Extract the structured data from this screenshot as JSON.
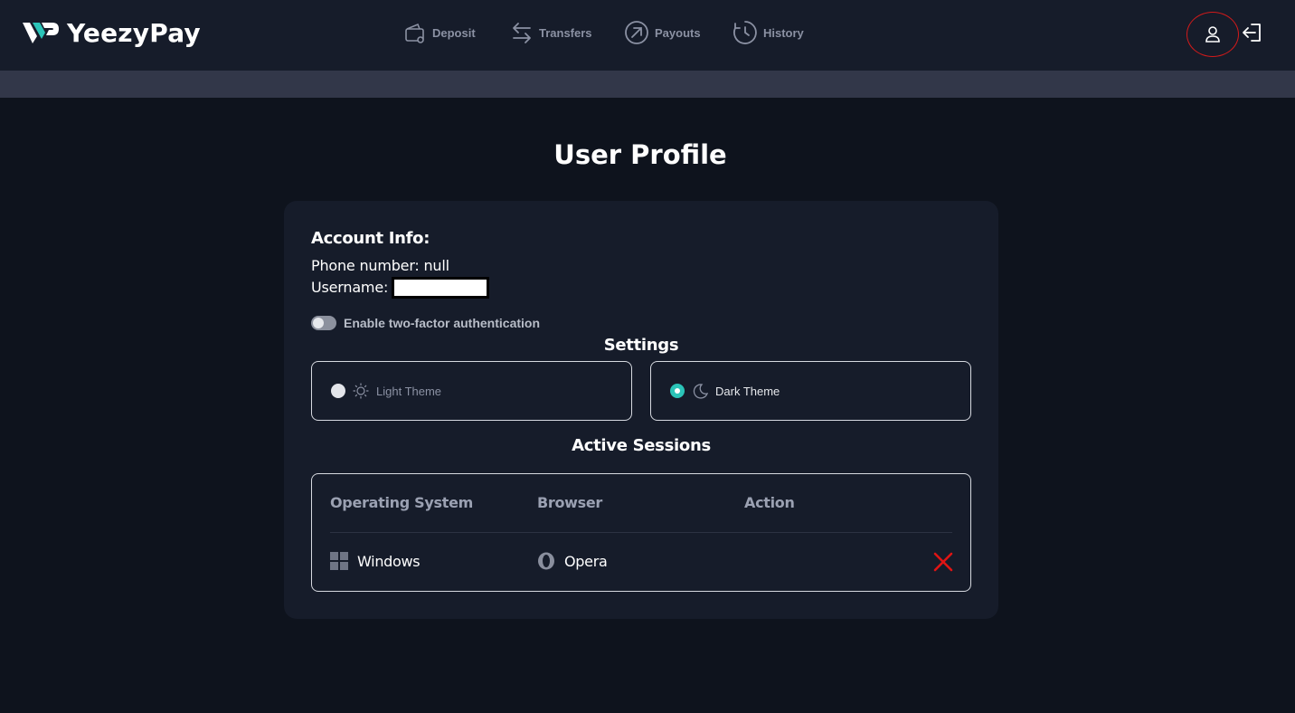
{
  "app": {
    "name": "YeezyPay"
  },
  "nav": {
    "items": [
      {
        "label": "Deposit",
        "icon": "wallet-icon"
      },
      {
        "label": "Transfers",
        "icon": "transfer-arrows-icon"
      },
      {
        "label": "Payouts",
        "icon": "arrow-up-right-circle-icon"
      },
      {
        "label": "History",
        "icon": "history-clock-icon"
      }
    ],
    "profile_icon": "user-icon",
    "logout_icon": "logout-icon"
  },
  "page": {
    "title": "User Profile"
  },
  "account": {
    "title": "Account Info:",
    "phone_line": "Phone number: null",
    "username_label": "Username:",
    "two_factor_label": "Enable two-factor authentication",
    "two_factor_enabled": false
  },
  "settings": {
    "title": "Settings",
    "themes": [
      {
        "label": "Light Theme",
        "icon": "sun-icon",
        "selected": false
      },
      {
        "label": "Dark Theme",
        "icon": "moon-icon",
        "selected": true
      }
    ]
  },
  "sessions": {
    "title": "Active Sessions",
    "headers": [
      "Operating System",
      "Browser",
      "Action"
    ],
    "rows": [
      {
        "os": "Windows",
        "os_icon": "windows-icon",
        "browser": "Opera",
        "browser_icon": "opera-icon",
        "action_icon": "close-icon"
      }
    ]
  },
  "colors": {
    "background": "#0e131d",
    "header": "#161c2a",
    "card": "#161c2a",
    "accent": "#2bc4b8",
    "danger": "#e01414"
  }
}
